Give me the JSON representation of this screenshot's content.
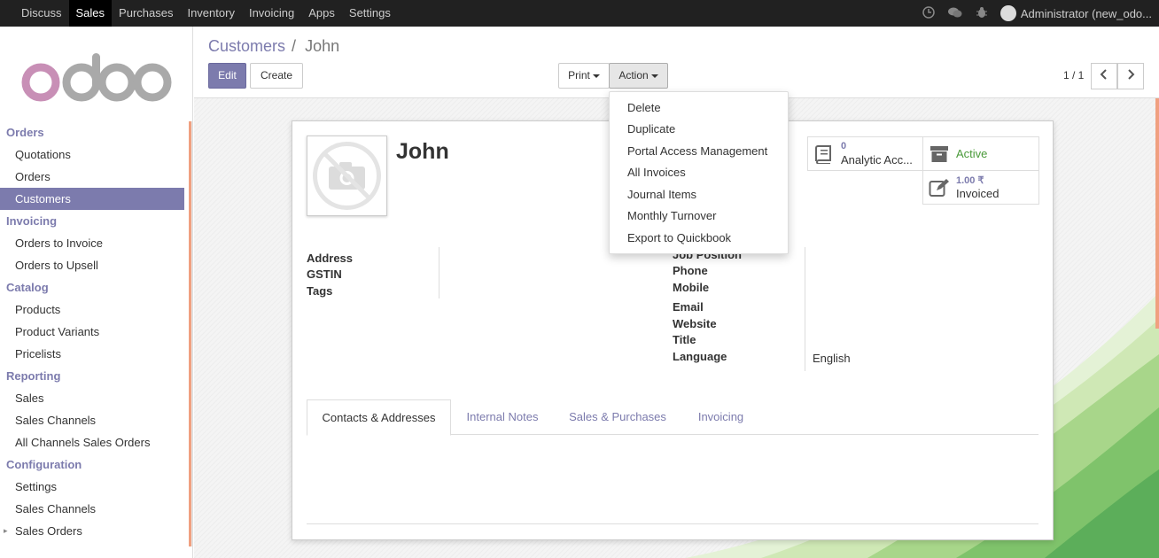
{
  "topbar": {
    "menu": [
      "Discuss",
      "Sales",
      "Purchases",
      "Inventory",
      "Invoicing",
      "Apps",
      "Settings"
    ],
    "active": "Sales",
    "user": "Administrator (new_odo..."
  },
  "sidebar": {
    "sections": [
      {
        "title": "Orders",
        "items": [
          "Quotations",
          "Orders",
          "Customers"
        ]
      },
      {
        "title": "Invoicing",
        "items": [
          "Orders to Invoice",
          "Orders to Upsell"
        ]
      },
      {
        "title": "Catalog",
        "items": [
          "Products",
          "Product Variants",
          "Pricelists"
        ]
      },
      {
        "title": "Reporting",
        "items": [
          "Sales",
          "Sales Channels",
          "All Channels Sales Orders"
        ]
      },
      {
        "title": "Configuration",
        "items": [
          "Settings",
          "Sales Channels",
          "Sales Orders"
        ]
      }
    ],
    "active_item": "Customers"
  },
  "breadcrumb": {
    "parent": "Customers",
    "current": "John",
    "separator": "/"
  },
  "buttons": {
    "edit": "Edit",
    "create": "Create",
    "print": "Print",
    "action": "Action"
  },
  "pager": {
    "value": "1 / 1"
  },
  "action_menu": [
    "Delete",
    "Duplicate",
    "Portal Access Management",
    "All Invoices",
    "Journal Items",
    "Monthly Turnover",
    "Export to Quickbook"
  ],
  "partner": {
    "name": "John",
    "smart_buttons": {
      "analytic": {
        "count": "0",
        "label": "Analytic Acc..."
      },
      "active": {
        "label": "Active"
      },
      "invoiced": {
        "amount": "1.00 ₹",
        "label": "Invoiced"
      }
    },
    "left_fields": [
      "Address",
      "GSTIN",
      "Tags"
    ],
    "right_fields": [
      "Job Position",
      "Phone",
      "Mobile",
      "Email",
      "Website",
      "Title",
      "Language"
    ],
    "language_value": "English"
  },
  "tabs": [
    "Contacts & Addresses",
    "Internal Notes",
    "Sales & Purchases",
    "Invoicing"
  ],
  "colors": {
    "accent": "#7c7bad",
    "topbar": "#212121",
    "active_green": "#4a9a3a"
  }
}
